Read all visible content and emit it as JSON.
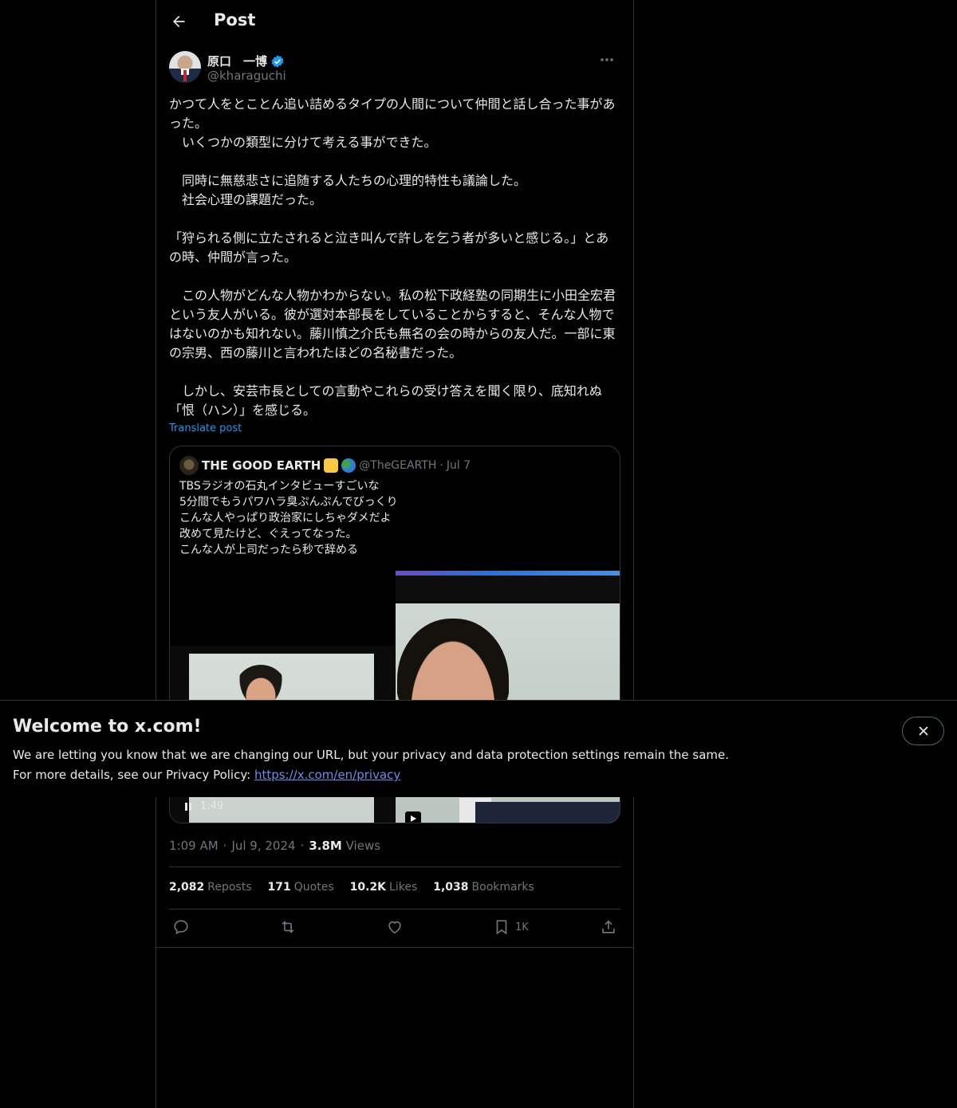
{
  "header": {
    "title": "Post"
  },
  "author": {
    "display_name": "原口　一博",
    "handle": "@kharaguchi"
  },
  "tweet": {
    "text": "かつて人をとことん追い詰めるタイプの人間について仲間と話し合った事があった。\n　いくつかの類型に分けて考える事ができた。\n\n　同時に無慈悲さに追随する人たちの心理的特性も議論した。\n　社会心理の課題だった。\n\n「狩られる側に立たされると泣き叫んで許しを乞う者が多いと感じる。」とあの時、仲間が言った。\n\n　この人物がどんな人物かわからない。私の松下政経塾の同期生に小田全宏君という友人がいる。彼が選対本部長をしていることからすると、そんな人物ではないのかも知れない。藤川慎之介氏も無名の会の時からの友人だ。一部に東の宗男、西の藤川と言われたほどの名秘書だった。\n\n　しかし、安芸市長としての言動やこれらの受け答えを聞く限り、底知れぬ「恨（ハン）」を感じる。",
    "translate_label": "Translate post"
  },
  "quote": {
    "name": "THE GOOD EARTH",
    "handle": "@TheGEARTH",
    "separator": "·",
    "date": "Jul 7",
    "text": "TBSラジオの石丸インタビューすごいな\n5分間でもうパワハラ臭ぷんぷんでびっくり\nこんな人やっぱり政治家にしちゃダメだよ\n改めて見たけど、ぐえってなった。\nこんな人が上司だったら秒で辞める",
    "video_time": "1:49"
  },
  "meta": {
    "time": "1:09 AM",
    "dot": "·",
    "date": "Jul 9, 2024",
    "views_count": "3.8M",
    "views_label": "Views"
  },
  "stats": {
    "reposts_count": "2,082",
    "reposts_label": "Reposts",
    "quotes_count": "171",
    "quotes_label": "Quotes",
    "likes_count": "10.2K",
    "likes_label": "Likes",
    "bookmarks_count": "1,038",
    "bookmarks_label": "Bookmarks"
  },
  "actions": {
    "bookmark_count": "1K"
  },
  "banner": {
    "title": "Welcome to x.com!",
    "line1": "We are letting you know that we are changing our URL, but your privacy and data protection settings remain the same.",
    "line2_prefix": "For more details, see our Privacy Policy: ",
    "link": "https://x.com/en/privacy"
  },
  "colors": {
    "background": "#000000",
    "accent": "#1d9bf0",
    "border": "#2f3336",
    "muted": "#71767b"
  },
  "icons": [
    "back-arrow-icon",
    "verified-badge-icon",
    "more-icon",
    "reply-icon",
    "repost-icon",
    "like-icon",
    "bookmark-icon",
    "share-icon",
    "close-icon",
    "pause-icon",
    "play-icon"
  ]
}
